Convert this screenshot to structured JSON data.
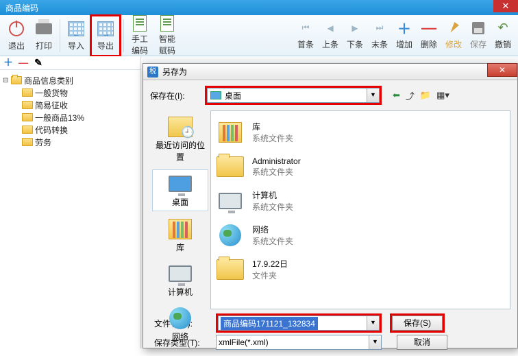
{
  "window": {
    "title": "商品编码"
  },
  "toolbar": {
    "exit": "退出",
    "print": "打印",
    "import": "导入",
    "export": "导出",
    "manual": "手工\n编码",
    "smart": "智能\n赋码",
    "first": "首条",
    "prev": "上条",
    "next": "下条",
    "last": "末条",
    "add": "增加",
    "del": "删除",
    "edit": "修改",
    "save": "保存",
    "undo": "撤销"
  },
  "tree": {
    "root": "商品信息类别",
    "items": [
      "一般货物",
      "简易征收",
      "一般商品13%",
      "代码转换",
      "劳务"
    ]
  },
  "dialog": {
    "title": "另存为",
    "save_in_label": "保存在(I):",
    "save_in_value": "桌面",
    "places": {
      "recent": "最近访问的位\n置",
      "desktop": "桌面",
      "library": "库",
      "computer": "计算机",
      "network": "网络"
    },
    "list": [
      {
        "name": "库",
        "sub": "系统文件夹",
        "icon": "lib"
      },
      {
        "name": "Administrator",
        "sub": "系统文件夹",
        "icon": "folder"
      },
      {
        "name": "计算机",
        "sub": "系统文件夹",
        "icon": "computer"
      },
      {
        "name": "网络",
        "sub": "系统文件夹",
        "icon": "network"
      },
      {
        "name": "17.9.22日",
        "sub": "文件夹",
        "icon": "folder"
      }
    ],
    "filename_label": "文件名(N):",
    "filename_value": "商品编码171121_132834",
    "filetype_label": "保存类型(T):",
    "filetype_value": "xmlFile(*.xml)",
    "save_btn": "保存(S)",
    "cancel_btn": "取消"
  }
}
